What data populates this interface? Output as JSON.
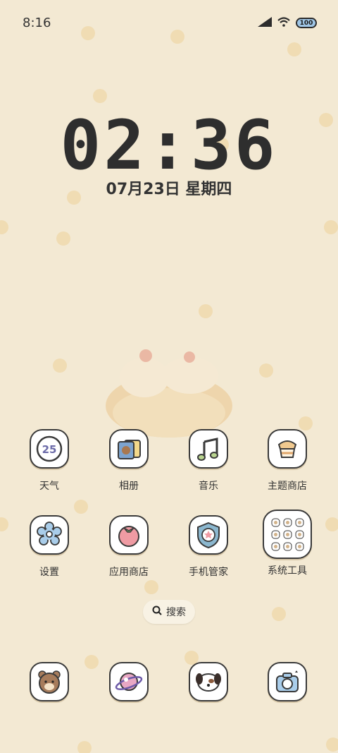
{
  "status_bar": {
    "time": "8:16",
    "battery": "100"
  },
  "lock": {
    "clock": "02:36",
    "date": "07月23日 星期四"
  },
  "apps_row1": [
    {
      "label": "天气",
      "icon": "weather-25-icon",
      "temp": "25"
    },
    {
      "label": "相册",
      "icon": "photo-album-icon"
    },
    {
      "label": "音乐",
      "icon": "music-note-icon"
    },
    {
      "label": "主题商店",
      "icon": "theme-store-icon"
    }
  ],
  "apps_row2": [
    {
      "label": "设置",
      "icon": "gear-flower-icon"
    },
    {
      "label": "应用商店",
      "icon": "app-store-tomato-icon"
    },
    {
      "label": "手机管家",
      "icon": "shield-star-icon"
    },
    {
      "label": "系统工具",
      "icon": "folder-icon"
    }
  ],
  "search": {
    "label": "搜索"
  },
  "dock": [
    {
      "icon": "bear-phone-icon"
    },
    {
      "icon": "planet-browser-icon"
    },
    {
      "icon": "dog-message-icon"
    },
    {
      "icon": "camera-icon"
    }
  ],
  "colors": {
    "background": "#f3e9d3",
    "dots": "#f0dcb3",
    "icon_border": "#3a3a3a"
  }
}
